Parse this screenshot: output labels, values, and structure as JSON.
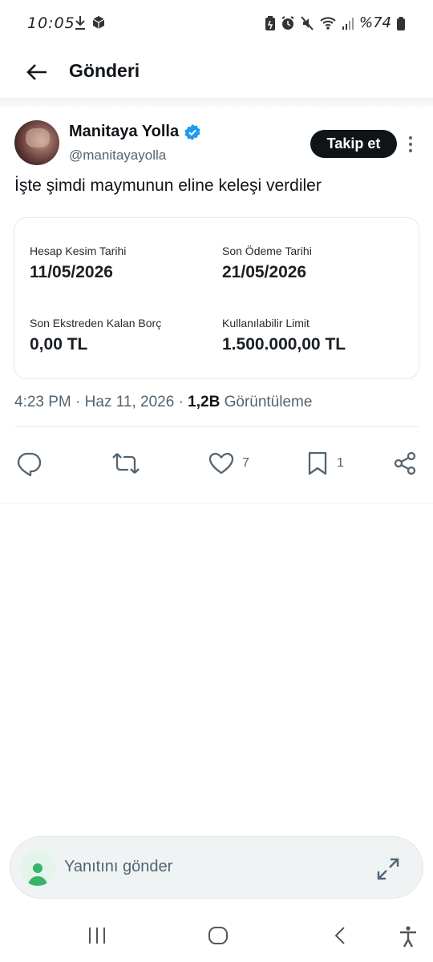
{
  "status_bar": {
    "time": "10:05",
    "battery": "%74",
    "icons": [
      "download-icon",
      "box-icon",
      "battery-saver-icon",
      "alarm-icon",
      "mute-icon",
      "wifi-icon",
      "signal-icon",
      "battery-icon"
    ]
  },
  "header": {
    "title": "Gönderi"
  },
  "post": {
    "display_name": "Manitaya Yolla",
    "handle": "@manitayayolla",
    "follow_label": "Takip et",
    "text": "İşte şimdi maymunun eline keleşi verdiler",
    "card": {
      "fields": [
        {
          "label": "Hesap Kesim Tarihi",
          "value": "11/05/2026"
        },
        {
          "label": "Son Ödeme Tarihi",
          "value": "21/05/2026"
        },
        {
          "label": "Son Ekstreden Kalan Borç",
          "value": "0,00 TL"
        },
        {
          "label": "Kullanılabilir Limit",
          "value": "1.500.000,00 TL"
        }
      ]
    },
    "time": "4:23 PM",
    "date": "Haz 11, 2026",
    "views_count": "1,2B",
    "views_label": "Görüntüleme",
    "likes": "7",
    "bookmarks": "1"
  },
  "reply": {
    "placeholder": "Yanıtını gönder"
  },
  "colors": {
    "verified": "#1d9bf0",
    "text_primary": "#0f1419",
    "text_secondary": "#536471",
    "reply_avatar": "#37b36a"
  }
}
